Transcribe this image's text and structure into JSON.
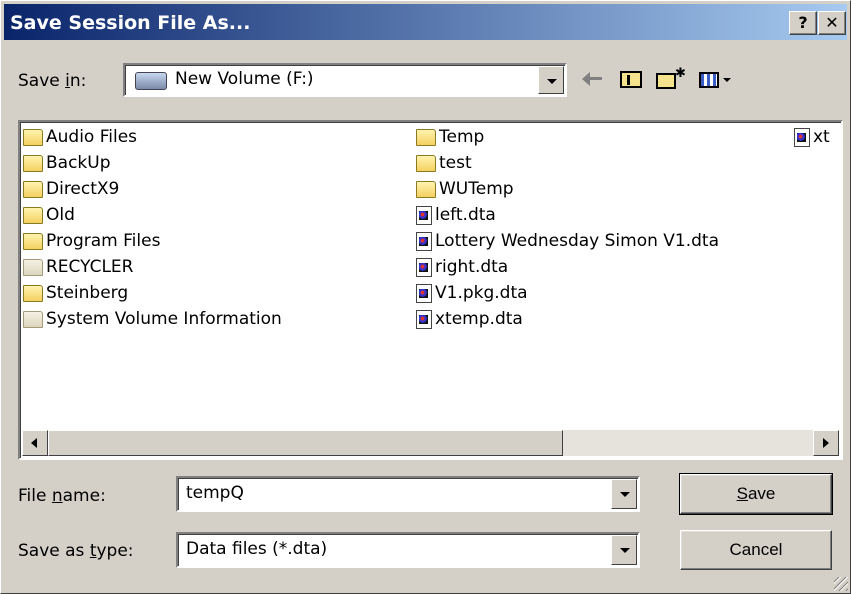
{
  "title": "Save Session File As...",
  "title_buttons": {
    "help": "?",
    "close": "✕"
  },
  "save_in": {
    "label": "Save in:",
    "value": "New Volume (F:)",
    "drive_icon": "hard-drive-icon"
  },
  "toolbar": {
    "back_icon": "back-arrow-icon",
    "up_icon": "up-folder-icon",
    "new_folder_icon": "new-folder-icon",
    "views_icon": "view-menu-icon"
  },
  "files": [
    {
      "name": "Audio Files",
      "type": "folder"
    },
    {
      "name": "BackUp",
      "type": "folder"
    },
    {
      "name": "DirectX9",
      "type": "folder"
    },
    {
      "name": "Old",
      "type": "folder"
    },
    {
      "name": "Program Files",
      "type": "folder"
    },
    {
      "name": "RECYCLER",
      "type": "folder-system"
    },
    {
      "name": "Steinberg",
      "type": "folder"
    },
    {
      "name": "System Volume Information",
      "type": "folder-system"
    },
    {
      "name": "Temp",
      "type": "folder"
    },
    {
      "name": "test",
      "type": "folder"
    },
    {
      "name": "WUTemp",
      "type": "folder"
    },
    {
      "name": "left.dta",
      "type": "file"
    },
    {
      "name": "Lottery Wednesday Simon V1.dta",
      "type": "file"
    },
    {
      "name": "right.dta",
      "type": "file"
    },
    {
      "name": "V1.pkg.dta",
      "type": "file"
    },
    {
      "name": "xtemp.dta",
      "type": "file"
    },
    {
      "name": "xt",
      "type": "file"
    }
  ],
  "file_name": {
    "label": "File name:",
    "value": "tempQ"
  },
  "save_as_type": {
    "label": "Save as type:",
    "value": "Data files (*.dta)"
  },
  "buttons": {
    "save": "Save",
    "cancel": "Cancel"
  }
}
